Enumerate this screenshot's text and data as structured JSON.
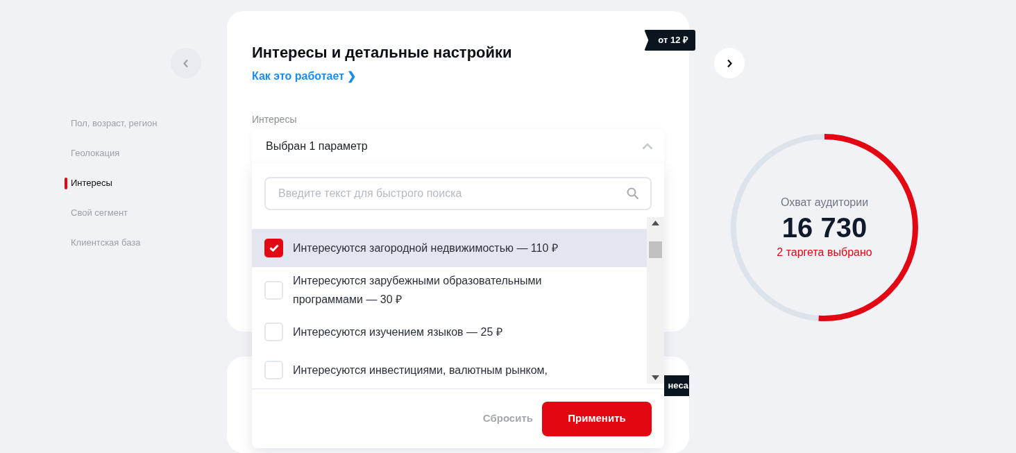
{
  "sidebar": {
    "items": [
      {
        "label": "Пол, возраст, регион",
        "selected": false
      },
      {
        "label": "Геолокация",
        "selected": false
      },
      {
        "label": "Интересы",
        "selected": true
      },
      {
        "label": "Свой сегмент",
        "selected": false
      },
      {
        "label": "Клиентская база",
        "selected": false
      }
    ]
  },
  "nav": {
    "prev_disabled": true,
    "next_disabled": false
  },
  "card": {
    "title": "Интересы и детальные настройки",
    "link": "Как это работает ❯",
    "price_badge": "от 12 ₽",
    "field_label": "Интересы",
    "dropdown": {
      "value": "Выбран 1 параметр",
      "expanded": true,
      "search_placeholder": "Введите текст для быстрого поиска",
      "options": [
        {
          "label": "Интересуются загородной недвижимостью — 110 ₽",
          "checked": true,
          "selected": true
        },
        {
          "label": "Интересуются зарубежными образовательными программами — 30 ₽",
          "checked": false,
          "selected": false
        },
        {
          "label": "Интересуются изучением языков — 25 ₽",
          "checked": false,
          "selected": false
        },
        {
          "label": "Интересуются инвестициями, валютным рынком,",
          "checked": false,
          "selected": false
        }
      ],
      "reset_button": "Сбросить",
      "apply_button": "Применить"
    }
  },
  "next_card": {
    "badge": "неса"
  },
  "reach": {
    "label": "Охват аудитории",
    "value": "16 730",
    "targets": "2 таргета выбрано",
    "level": 0.51
  }
}
